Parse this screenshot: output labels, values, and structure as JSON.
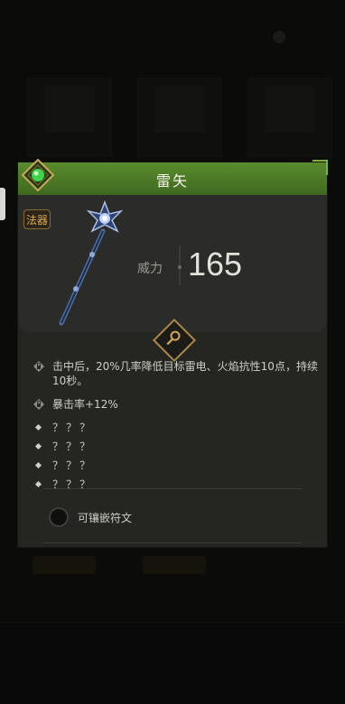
{
  "item": {
    "name": "雷矢",
    "category_badge": "法器",
    "stat": {
      "label": "威力",
      "value": "165"
    },
    "attributes": [
      {
        "icon": "lock-icon",
        "text": "击中后，20%几率降低目标雷电、火焰抗性10点，持续10秒。"
      },
      {
        "icon": "lock-icon",
        "text": "暴击率+12%"
      },
      {
        "icon": "diamond-bullet-icon",
        "text": "？？？"
      },
      {
        "icon": "diamond-bullet-icon",
        "text": "？？？"
      },
      {
        "icon": "diamond-bullet-icon",
        "text": "？？？"
      },
      {
        "icon": "diamond-bullet-icon",
        "text": "？？？"
      }
    ],
    "socket_label": "可镶嵌符文"
  },
  "colors": {
    "header_green": "#4f7d28",
    "accent_gold": "#b0874a",
    "badge_orange": "#d9a84f"
  }
}
